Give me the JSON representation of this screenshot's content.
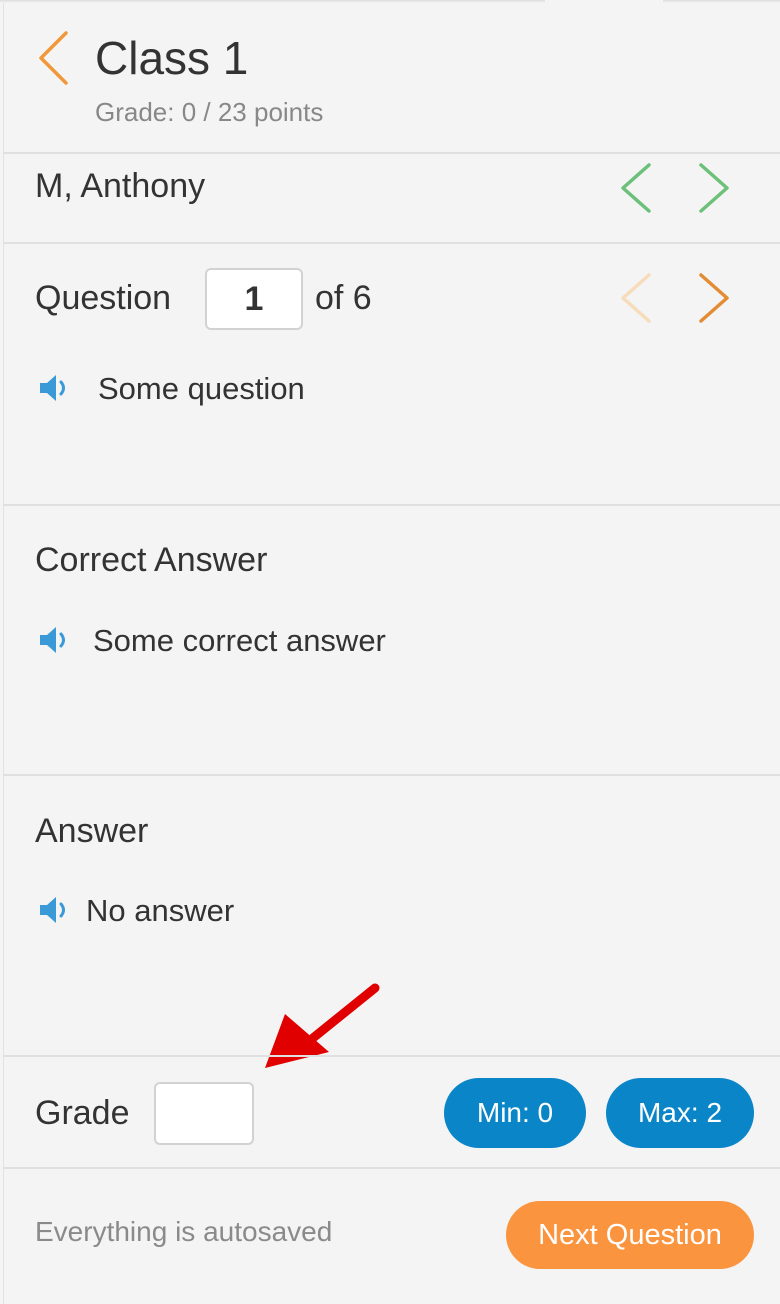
{
  "header": {
    "title": "Class 1",
    "grade_summary": "Grade: 0 / 23 points",
    "back_icon": "chevron-left-icon"
  },
  "student": {
    "name": "M, Anthony",
    "prev_icon": "chevron-left-icon",
    "next_icon": "chevron-right-icon"
  },
  "question": {
    "label": "Question",
    "number": "1",
    "of_label": "of 6",
    "text": "Some question",
    "speaker_icon": "speaker-icon"
  },
  "correct_answer": {
    "heading": "Correct Answer",
    "text": "Some correct answer"
  },
  "answer": {
    "heading": "Answer",
    "text": "No answer"
  },
  "grade": {
    "label": "Grade",
    "value": "",
    "min_label": "Min: 0",
    "max_label": "Max: 2"
  },
  "footer": {
    "autosave_text": "Everything is autosaved",
    "next_label": "Next Question"
  },
  "colors": {
    "accent_orange": "#fa943e",
    "accent_blue": "#0a85c8",
    "student_nav_green": "#6cc07a",
    "annotation_red": "#e00000"
  }
}
